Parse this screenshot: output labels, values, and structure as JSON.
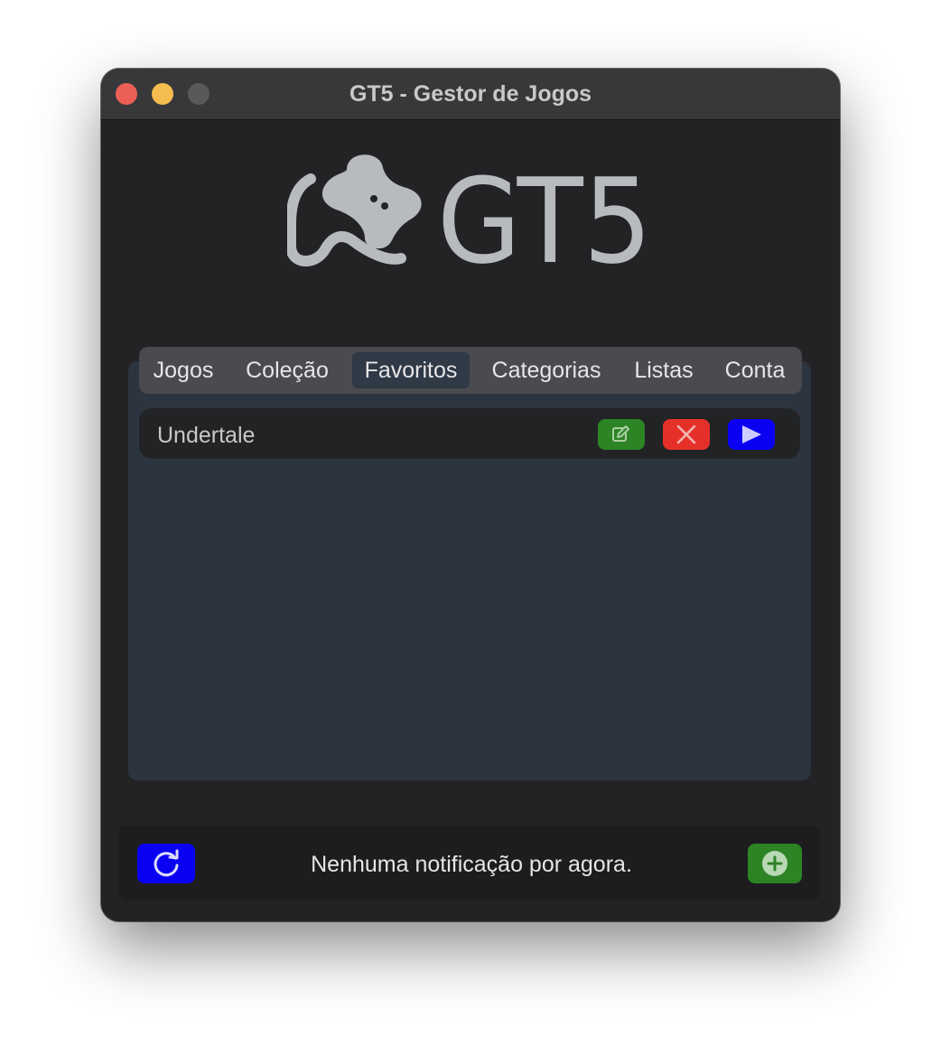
{
  "window": {
    "title": "GT5 - Gestor de Jogos"
  },
  "logo": {
    "text": "GT5",
    "icon": "gamepad-icon",
    "color": "#b7babe"
  },
  "tabs": [
    {
      "label": "Jogos",
      "active": false
    },
    {
      "label": "Coleção",
      "active": false
    },
    {
      "label": "Favoritos",
      "active": true
    },
    {
      "label": "Categorias",
      "active": false
    },
    {
      "label": "Listas",
      "active": false
    },
    {
      "label": "Conta",
      "active": false
    }
  ],
  "favorites": [
    {
      "name": "Undertale",
      "actions": [
        {
          "icon": "edit-icon",
          "color": "#2d8425"
        },
        {
          "icon": "close-icon",
          "color": "#e5302a"
        },
        {
          "icon": "play-icon",
          "color": "#0a00f2"
        }
      ]
    }
  ],
  "statusbar": {
    "notification": "Nenhuma notificação por agora.",
    "refresh_icon": "refresh-icon",
    "add_icon": "plus-circle-icon"
  },
  "colors": {
    "window_bg": "#232325",
    "panel_bg": "#2c343f",
    "tabbar_bg": "#4a4b4e",
    "accent_blue": "#0a00f2",
    "accent_green": "#2d8425",
    "accent_red": "#e5302a"
  }
}
